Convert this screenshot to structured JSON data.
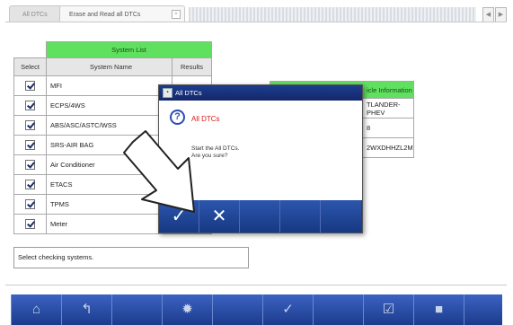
{
  "tabs": [
    {
      "label": "All DTCs"
    },
    {
      "label": "Erase and Read all DTCs"
    }
  ],
  "system_list": {
    "title": "System List",
    "columns": [
      "Select",
      "System Name",
      "Results"
    ],
    "rows": [
      {
        "name": "MFI",
        "selected": true
      },
      {
        "name": "ECPS/4WS",
        "selected": true
      },
      {
        "name": "ABS/ASC/ASTC/WSS",
        "selected": true
      },
      {
        "name": "SRS-AIR BAG",
        "selected": true
      },
      {
        "name": "Air Conditioner",
        "selected": true
      },
      {
        "name": "ETACS",
        "selected": true
      },
      {
        "name": "TPMS",
        "selected": true
      },
      {
        "name": "Meter",
        "selected": true
      }
    ]
  },
  "vehicle_info": {
    "header": "icle Information",
    "rows": [
      "TLANDER-PHEV",
      "8",
      "2WXDHHZL2M"
    ]
  },
  "status_text": "Select checking systems.",
  "dialog": {
    "title": "All DTCs",
    "heading": "All DTCs",
    "message_line1": "Start the All DTCs.",
    "message_line2": "Are you sure?",
    "ok_icon": "check-icon",
    "cancel_icon": "close-icon"
  },
  "toolbar_icons": [
    "home-icon",
    "back-icon",
    "blank",
    "settings-icon",
    "blank",
    "check-icon",
    "blank",
    "check-icon",
    "stop-icon",
    "blank"
  ],
  "colors": {
    "header_green": "#5fe05f",
    "dialog_blue": "#1d3c8f",
    "toolbar_blue": "#2c4fa8",
    "alert_red": "#d61a1a"
  }
}
